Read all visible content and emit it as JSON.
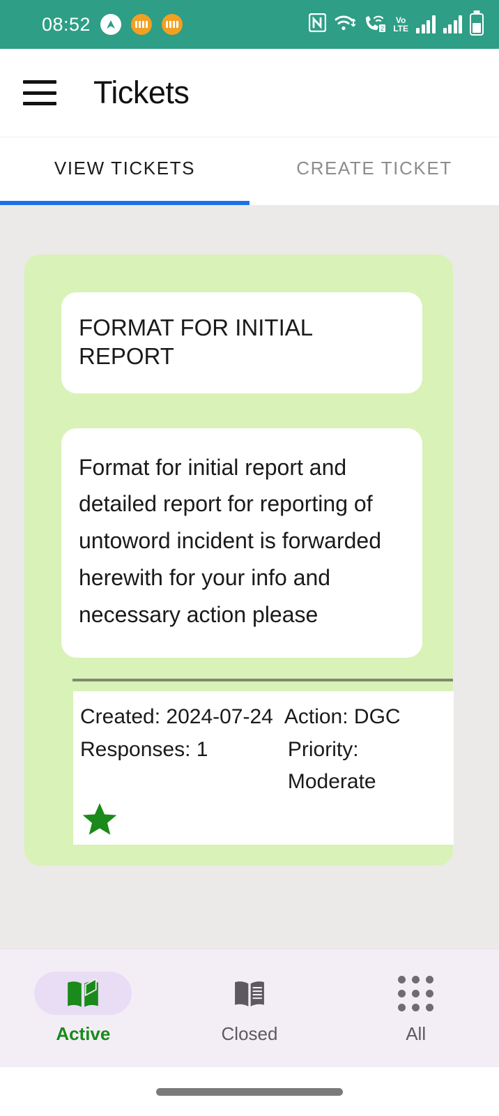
{
  "status_bar": {
    "time": "08:52",
    "background_color": "#2e9e86",
    "left_icons": [
      "caret-up-circle-icon",
      "vpn-orange-icon",
      "vpn-orange-icon"
    ],
    "right_icons": [
      "nfc-icon",
      "wifi-icon",
      "vowifi-call-icon",
      "volte-icon",
      "signal-bars-sim1-icon",
      "signal-bars-sim2-icon",
      "battery-icon"
    ],
    "volte_label_top": "Vo",
    "volte_label_bottom": "LTE",
    "sim_badge": "2"
  },
  "app_bar": {
    "menu_icon": "hamburger-menu-icon",
    "title": "Tickets"
  },
  "tabs": {
    "indicator_color": "#1a73e8",
    "items": [
      {
        "label": "VIEW TICKETS",
        "active": true
      },
      {
        "label": "CREATE TICKET",
        "active": false
      }
    ]
  },
  "ticket": {
    "card_color": "#d9f2b8",
    "title": "FORMAT FOR INITIAL REPORT",
    "body": "Format for initial report and detailed report for reporting of\nuntoword incident is forwarded herewith for your info and necessary action please",
    "meta": {
      "created_label": "Created: 2024-07-24",
      "action_label": "Action: DGC",
      "responses_label": "Responses: 1",
      "priority_label": "Priority: Moderate",
      "star_icon": "star-icon",
      "star_color": "#1a8a1a"
    }
  },
  "bottom_nav": {
    "background_color": "#f3eef5",
    "items": [
      {
        "label": "Active",
        "icon": "open-book-icon",
        "selected": true,
        "color": "#1a8a1a"
      },
      {
        "label": "Closed",
        "icon": "closed-book-icon",
        "selected": false,
        "color": "#5d5a5f"
      },
      {
        "label": "All",
        "icon": "apps-grid-icon",
        "selected": false,
        "color": "#5d5a5f"
      }
    ]
  },
  "gesture_bar": {
    "home_indicator": "home-indicator"
  }
}
